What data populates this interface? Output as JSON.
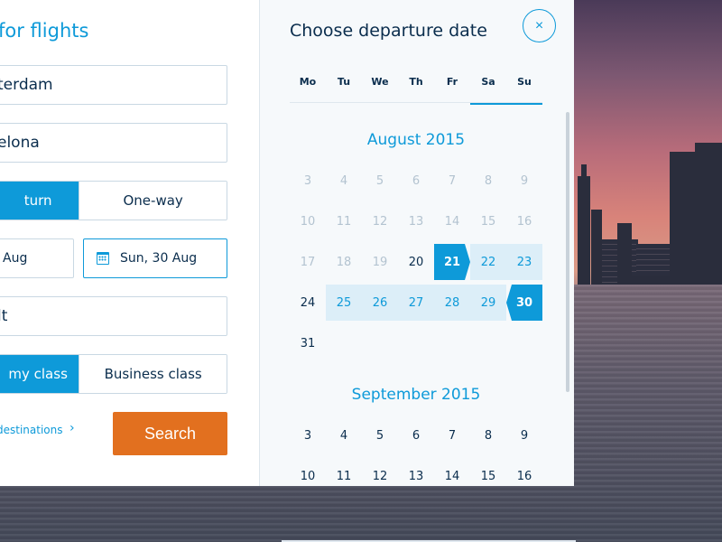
{
  "search_form": {
    "title": "for flights",
    "from_value": "terdam",
    "to_value": "elona",
    "trip_type": {
      "options": [
        "turn",
        "One-way"
      ],
      "selected": 0
    },
    "depart_value": "Aug",
    "return_value": "Sun, 30 Aug",
    "passengers_value": "lt",
    "cabin_class": {
      "options": [
        "my class",
        "Business class"
      ],
      "selected": 0
    },
    "more_link": "destinations",
    "more_chevron": "›",
    "search_label": "Search"
  },
  "calendar": {
    "title": "Choose departure date",
    "close_icon": "×",
    "weekdays": [
      "Mo",
      "Tu",
      "We",
      "Th",
      "Fr",
      "Sa",
      "Su"
    ],
    "months": [
      {
        "label": "August 2015",
        "rows": [
          [
            {
              "d": "3",
              "s": "disabled"
            },
            {
              "d": "4",
              "s": "disabled"
            },
            {
              "d": "5",
              "s": "disabled"
            },
            {
              "d": "6",
              "s": "disabled"
            },
            {
              "d": "7",
              "s": "disabled"
            },
            {
              "d": "8",
              "s": "disabled"
            },
            {
              "d": "9",
              "s": "disabled"
            }
          ],
          [
            {
              "d": "10",
              "s": "disabled"
            },
            {
              "d": "11",
              "s": "disabled"
            },
            {
              "d": "12",
              "s": "disabled"
            },
            {
              "d": "13",
              "s": "disabled"
            },
            {
              "d": "14",
              "s": "disabled"
            },
            {
              "d": "15",
              "s": "disabled"
            },
            {
              "d": "16",
              "s": "disabled"
            }
          ],
          [
            {
              "d": "17",
              "s": "disabled"
            },
            {
              "d": "18",
              "s": "disabled"
            },
            {
              "d": "19",
              "s": "disabled"
            },
            {
              "d": "20",
              "s": "normal"
            },
            {
              "d": "21",
              "s": "sel-start"
            },
            {
              "d": "22",
              "s": "inrange"
            },
            {
              "d": "23",
              "s": "inrange"
            }
          ],
          [
            {
              "d": "24",
              "s": "normal"
            },
            {
              "d": "25",
              "s": "inrange"
            },
            {
              "d": "26",
              "s": "inrange"
            },
            {
              "d": "27",
              "s": "inrange"
            },
            {
              "d": "28",
              "s": "inrange"
            },
            {
              "d": "29",
              "s": "inrange"
            },
            {
              "d": "30",
              "s": "sel-end"
            }
          ],
          [
            {
              "d": "31",
              "s": "normal"
            }
          ]
        ]
      },
      {
        "label": "September 2015",
        "rows": [
          [
            {
              "d": "3",
              "s": "normal"
            },
            {
              "d": "4",
              "s": "normal"
            },
            {
              "d": "5",
              "s": "normal"
            },
            {
              "d": "6",
              "s": "normal"
            },
            {
              "d": "7",
              "s": "normal"
            },
            {
              "d": "8",
              "s": "normal"
            },
            {
              "d": "9",
              "s": "normal"
            }
          ],
          [
            {
              "d": "10",
              "s": "normal"
            },
            {
              "d": "11",
              "s": "normal"
            },
            {
              "d": "12",
              "s": "normal"
            },
            {
              "d": "13",
              "s": "normal"
            },
            {
              "d": "14",
              "s": "normal"
            },
            {
              "d": "15",
              "s": "normal"
            },
            {
              "d": "16",
              "s": "normal"
            }
          ]
        ]
      }
    ]
  },
  "colors": {
    "accent": "#0e9ad9",
    "search_button": "#e2701f",
    "text_dark": "#0a2d4d",
    "disabled_text": "#b3c3d0",
    "range_fill": "#dceef8"
  }
}
